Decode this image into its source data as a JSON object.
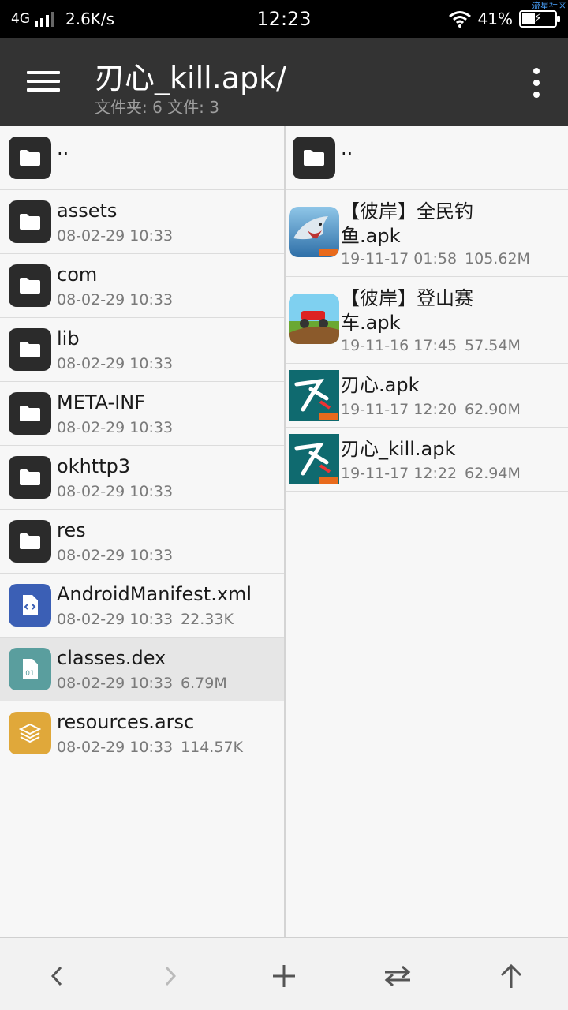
{
  "status_bar": {
    "network": "4G",
    "speed": "2.6K/s",
    "time": "12:23",
    "battery": "41%",
    "watermark": "流星社区"
  },
  "toolbar": {
    "title": "刃心_kill.apk/",
    "subtitle": "文件夹: 6  文件: 3"
  },
  "left_pane": {
    "items": [
      {
        "name": "..",
        "date": "",
        "size": "",
        "icon": "folder-icon"
      },
      {
        "name": "assets",
        "date": "08-02-29 10:33",
        "size": "",
        "icon": "folder-icon"
      },
      {
        "name": "com",
        "date": "08-02-29 10:33",
        "size": "",
        "icon": "folder-icon"
      },
      {
        "name": "lib",
        "date": "08-02-29 10:33",
        "size": "",
        "icon": "folder-icon"
      },
      {
        "name": "META-INF",
        "date": "08-02-29 10:33",
        "size": "",
        "icon": "folder-icon"
      },
      {
        "name": "okhttp3",
        "date": "08-02-29 10:33",
        "size": "",
        "icon": "folder-icon"
      },
      {
        "name": "res",
        "date": "08-02-29 10:33",
        "size": "",
        "icon": "folder-icon"
      },
      {
        "name": "AndroidManifest.xml",
        "date": "08-02-29 10:33",
        "size": "22.33K",
        "icon": "xml-file-icon"
      },
      {
        "name": "classes.dex",
        "date": "08-02-29 10:33",
        "size": "6.79M",
        "icon": "dex-file-icon"
      },
      {
        "name": "resources.arsc",
        "date": "08-02-29 10:33",
        "size": "114.57K",
        "icon": "layers-file-icon"
      }
    ]
  },
  "right_pane": {
    "parent": "..",
    "items": [
      {
        "name": "【彼岸】全民钓鱼.apk",
        "date": "19-11-17 01:58",
        "size": "105.62M",
        "icon": "shark-app-icon"
      },
      {
        "name": "【彼岸】登山赛车.apk",
        "date": "19-11-16 17:45",
        "size": "57.54M",
        "icon": "hill-climb-app-icon"
      },
      {
        "name": "刃心.apk",
        "date": "19-11-17 12:20",
        "size": "62.90M",
        "icon": "blade-app-icon"
      },
      {
        "name": "刃心_kill.apk",
        "date": "19-11-17 12:22",
        "size": "62.94M",
        "icon": "blade-app-icon"
      }
    ]
  },
  "colors": {
    "toolbar_bg": "#333333",
    "xml_icon": "#3b5fb5",
    "dex_icon": "#5a9e9e",
    "arsc_icon": "#e0a83a",
    "folder_icon": "#2b2b2b"
  },
  "bottom_bar": {
    "buttons": [
      "back-icon",
      "forward-icon",
      "add-icon",
      "swap-icon",
      "up-icon"
    ]
  }
}
